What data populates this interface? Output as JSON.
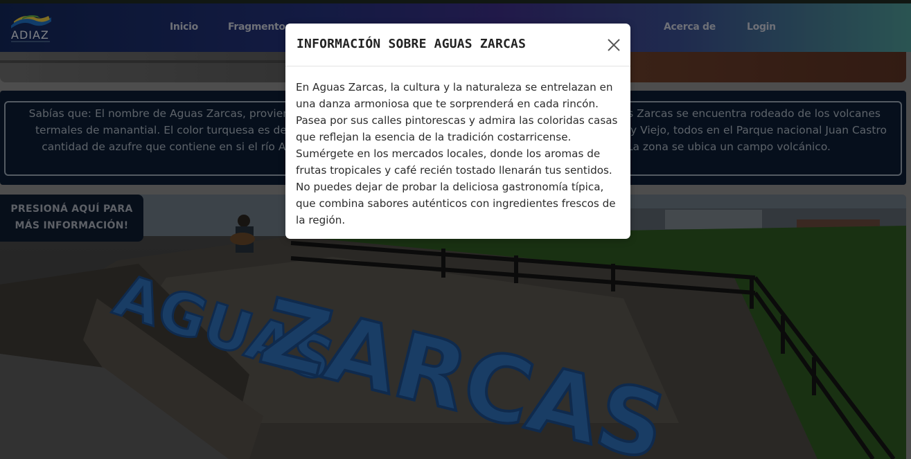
{
  "nav": {
    "logo_text": "ADIAZ",
    "items": [
      "Inicio",
      "Fragmentos",
      "",
      "",
      "Acerca de",
      "Login"
    ]
  },
  "facts": {
    "left": "Sabías que: El nombre de Aguas Zarcas, proviene de las aguas termales de manantial. El color turquesa es debido a la gran cantidad de azufre que contiene en si el río Aguas Zarcas.",
    "right": "Sabías que: Aguas Zarcas se encuentra rodeado de los volcanes Platanar, Porvenir, y Viejo, todos en el Parque nacional Juan Castro Blanco. La zona se ubica un campo volcánico."
  },
  "info_button": {
    "label": "PRESIONÁ AQUÍ PARA MÁS INFORMACIÓN!"
  },
  "photo": {
    "sign_text": "AGUAS ZARCAS"
  },
  "modal": {
    "title": "INFORMACIÓN SOBRE AGUAS ZARCAS",
    "body": "En Aguas Zarcas, la cultura y la naturaleza se entrelazan en una danza armoniosa que te sorprenderá en cada rincón. Pasea por sus calles pintorescas y admira las coloridas casas que reflejan la esencia de la tradición costarricense. Sumérgete en los mercados locales, donde los aromas de frutas tropicales y café recién tostado llenarán tus sentidos. No puedes dejar de probar la deliciosa gastronomía típica, que combina sabores auténticos con ingredientes frescos de la región."
  },
  "colors": {
    "nav_start": "#13275a",
    "nav_end": "#4e9a96",
    "facts_bg": "#0c1d33",
    "sign_blue": "#2f6fb8"
  }
}
